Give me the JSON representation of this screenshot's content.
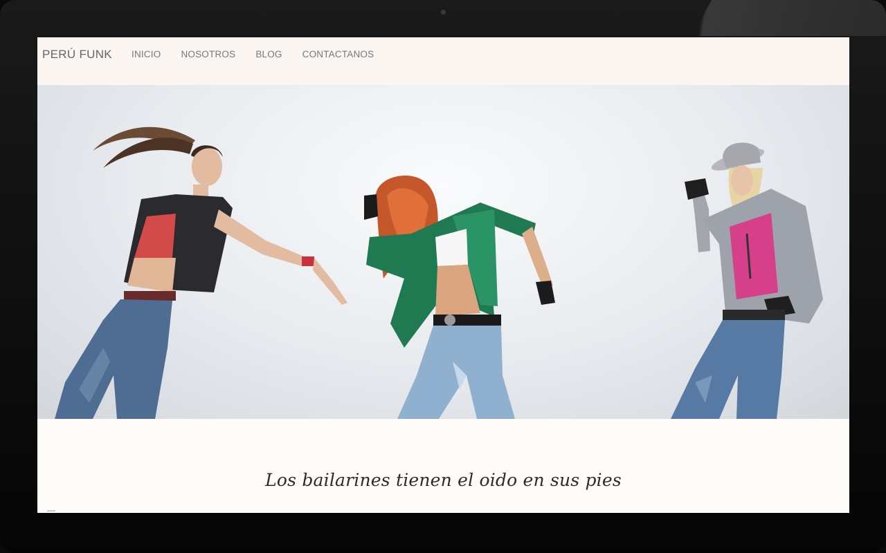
{
  "navbar": {
    "brand": "PERÚ FUNK",
    "links": [
      {
        "label": "INICIO"
      },
      {
        "label": "NOSOTROS"
      },
      {
        "label": "BLOG"
      },
      {
        "label": "CONTACTANOS"
      }
    ]
  },
  "hero": {
    "image": "dancers-photo"
  },
  "tagline": {
    "text": "Los bailarines tienen el oido en sus pies"
  },
  "colors": {
    "nav_bg": "#fbf6f2",
    "page_bg": "#fdfcf8",
    "bezel": "#0a0a0a",
    "text": "#2e2a28"
  }
}
